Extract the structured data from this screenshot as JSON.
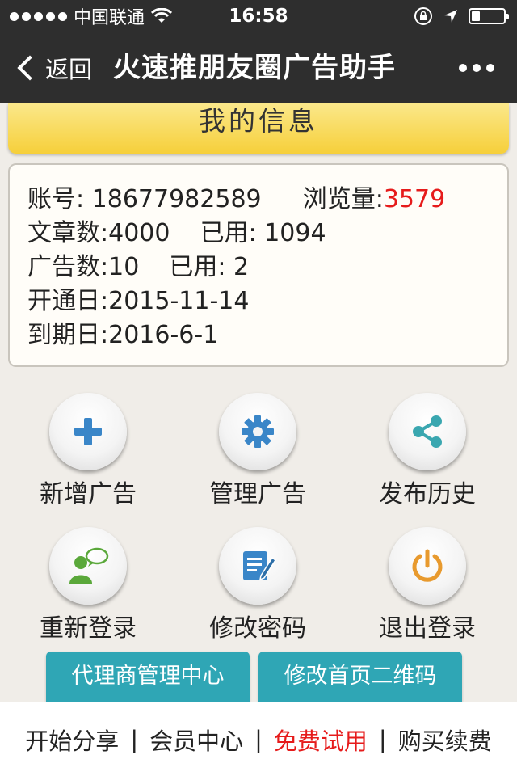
{
  "status_bar": {
    "carrier": "中国联通",
    "time": "16:58",
    "battery_level": 0.25
  },
  "nav": {
    "back_label": "返回",
    "title": "火速推朋友圈广告助手"
  },
  "header": {
    "title": "我的信息"
  },
  "info": {
    "account_label": "账号: ",
    "account": "18677982589",
    "views_label": "浏览量:",
    "views": "3579",
    "articles_label": "文章数:",
    "articles": "4000",
    "articles_used_label": "已用: ",
    "articles_used": "1094",
    "ads_label": "广告数:",
    "ads": "10",
    "ads_used_label": "已用: ",
    "ads_used": "2",
    "open_date_label": "开通日:",
    "open_date": "2015-11-14",
    "expire_date_label": "到期日:",
    "expire_date": "2016-6-1"
  },
  "grid": {
    "add_ad": "新增广告",
    "manage_ad": "管理广告",
    "history": "发布历史",
    "relogin": "重新登录",
    "change_password": "修改密码",
    "logout": "退出登录"
  },
  "buttons": {
    "agent_center": "代理商管理中心",
    "edit_qrcode": "修改首页二维码"
  },
  "bottom_bar": {
    "start_share": "开始分享",
    "member_center": "会员中心",
    "free_trial": "免费试用",
    "buy_renew": "购买续费",
    "separator": "|"
  },
  "colors": {
    "accent_red": "#e61b1b",
    "teal": "#2fa6b5",
    "header_yellow": "#f6cf3a",
    "icon_blue": "#3a86c8",
    "icon_teal": "#3aa7b0",
    "icon_orange": "#e89a2e",
    "icon_green": "#5aa83a"
  },
  "icons": {
    "add_ad": "plus-icon",
    "manage_ad": "gear-icon",
    "history": "share-icon",
    "relogin": "user-chat-icon",
    "change_password": "edit-document-icon",
    "logout": "power-icon"
  }
}
